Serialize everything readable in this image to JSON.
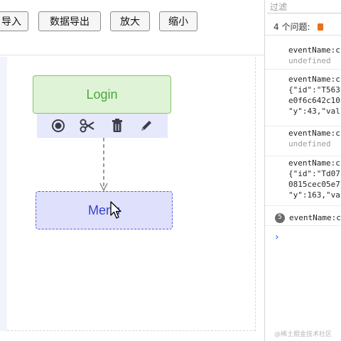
{
  "toolbar": {
    "import_label": "导入",
    "export_label": "数据导出",
    "zoom_in_label": "放大",
    "zoom_out_label": "缩小"
  },
  "graph": {
    "nodes": [
      {
        "label": "Login",
        "state": "normal",
        "fill": "#dff3d6",
        "border": "#82c66b",
        "text_color": "#4aa83a"
      },
      {
        "label": "Menu",
        "state": "selected",
        "fill": "#dfe0fb",
        "border": "#5b62d8",
        "text_color": "#3840d0"
      }
    ],
    "node_actions": [
      "record-icon",
      "scissors-icon",
      "trash-icon",
      "pencil-icon"
    ],
    "edge": {
      "from": "Login",
      "to": "Menu",
      "style": "dashed"
    }
  },
  "console": {
    "filter_placeholder": "过滤",
    "issues_label": "4 个问题:",
    "logs": [
      {
        "lines": [
          "eventName:c",
          "undefined"
        ]
      },
      {
        "lines": [
          "eventName:c",
          "{\"id\":\"T563",
          "e0f6c642c10",
          "\"y\":43,\"val"
        ]
      },
      {
        "lines": [
          "eventName:c",
          "undefined"
        ]
      },
      {
        "lines": [
          "eventName:c",
          "{\"id\":\"Td07",
          "0815cec05e7",
          "\"y\":163,\"va"
        ]
      },
      {
        "badge": "5",
        "lines": [
          "eventName:c"
        ]
      }
    ],
    "prompt": "›"
  },
  "watermark": "@稀土掘金技术社区",
  "colors": {
    "accent": "#1a73e8",
    "issue": "#e8711c"
  }
}
